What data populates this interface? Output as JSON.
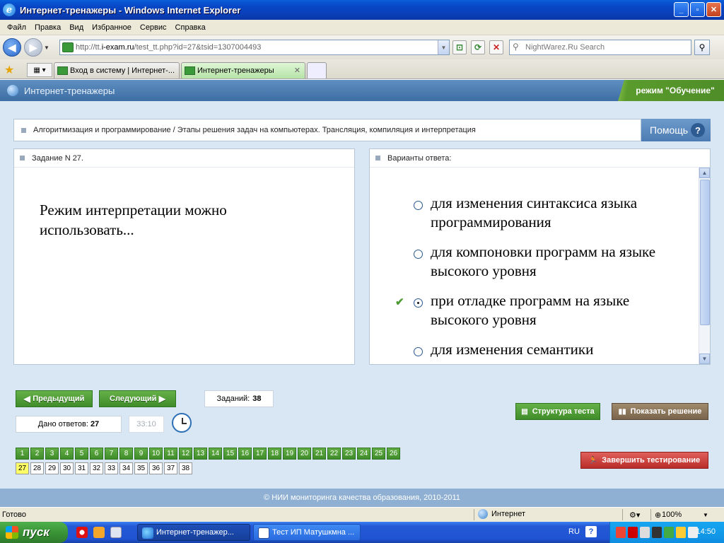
{
  "window": {
    "title": "Интернет-тренажеры - Windows Internet Explorer",
    "buttons": {
      "minimize": "_",
      "maximize": "▫",
      "close": "✕"
    }
  },
  "menu": [
    "Файл",
    "Правка",
    "Вид",
    "Избранное",
    "Сервис",
    "Справка"
  ],
  "address": {
    "url_prefix": "http://tt.",
    "url_host": "i-exam.ru",
    "url_rest": "/test_tt.php?id=27&tsid=1307004493",
    "search_placeholder": "NightWarez.Ru Search"
  },
  "tabs": [
    {
      "label": "Вход в систему | Интернет-...",
      "active": false
    },
    {
      "label": "Интернет-тренажеры",
      "active": true
    }
  ],
  "app": {
    "title": "Интернет-тренажеры",
    "mode": "режим \"Обучение\"",
    "breadcrumb": "Алгоритмизация и программирование / Этапы решения задач на компьютерах. Трансляция, компиляция и интерпретация",
    "help_label": "Помощь",
    "help_icon": "?",
    "task_header": "Задание N 27.",
    "question": "Режим интерпретации можно использовать...",
    "answers_header": "Варианты ответа:",
    "answers": [
      {
        "text": "для изменения синтаксиса языка программирования",
        "selected": false,
        "correct": false
      },
      {
        "text": "для компоновки программ на языке высокого уровня",
        "selected": false,
        "correct": false
      },
      {
        "text": "при отладке программ на языке высокого уровня",
        "selected": true,
        "correct": true
      },
      {
        "text": "для изменения семантики",
        "selected": false,
        "correct": false
      }
    ],
    "check_icon": "✔",
    "prev_label": "Предыдущий",
    "next_label": "Следующий",
    "tasks_label": "Заданий:",
    "tasks_count": "38",
    "answered_label": "Дано ответов:",
    "answered_count": "27",
    "timer": "33:10",
    "structure_label": "Структура теста",
    "solution_label": "Показать решение",
    "finish_label": "Завершить тестирование",
    "questions_done": [
      "1",
      "2",
      "3",
      "4",
      "5",
      "6",
      "7",
      "8",
      "9",
      "10",
      "11",
      "12",
      "13",
      "14",
      "15",
      "16",
      "17",
      "18",
      "19",
      "20",
      "21",
      "22",
      "23",
      "24",
      "25",
      "26"
    ],
    "question_current": "27",
    "questions_todo": [
      "28",
      "29",
      "30",
      "31",
      "32",
      "33",
      "34",
      "35",
      "36",
      "37",
      "38"
    ],
    "footer": "© НИИ мониторинга качества образования, 2010-2011"
  },
  "status": {
    "ready": "Готово",
    "zone": "Интернет",
    "zoom": "100%"
  },
  "taskbar": {
    "start": "пуск",
    "items": [
      "Интернет-тренажер...",
      "Тест ИП Матушкмна ..."
    ],
    "lang": "RU",
    "clock": "14:50"
  },
  "colors": {
    "app_header": "#4a7cb3",
    "mode_badge": "#5a9b2d",
    "done_cell": "#4f9a36",
    "current_cell": "#ffff66",
    "finish_button": "#c9403a"
  }
}
